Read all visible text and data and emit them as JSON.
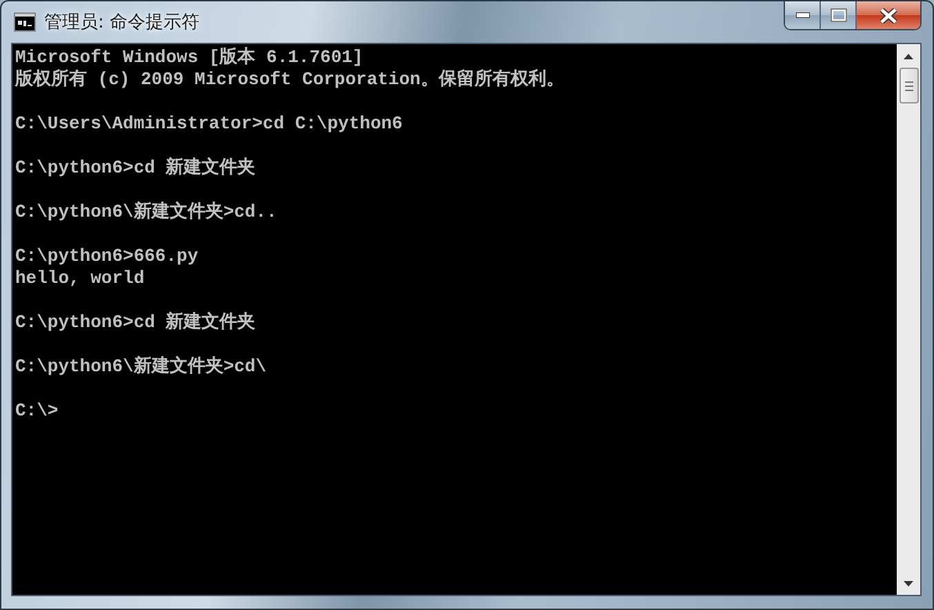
{
  "window": {
    "title": "管理员: 命令提示符"
  },
  "console": {
    "lines": [
      {
        "kind": "text",
        "text": "Microsoft Windows [版本 6.1.7601]"
      },
      {
        "kind": "text",
        "text": "版权所有 (c) 2009 Microsoft Corporation。保留所有权利。"
      },
      {
        "kind": "blank"
      },
      {
        "kind": "text",
        "text": "C:\\Users\\Administrator>cd C:\\python6"
      },
      {
        "kind": "blank"
      },
      {
        "kind": "text",
        "text": "C:\\python6>cd 新建文件夹"
      },
      {
        "kind": "blank"
      },
      {
        "kind": "text",
        "text": "C:\\python6\\新建文件夹>cd.."
      },
      {
        "kind": "blank"
      },
      {
        "kind": "text",
        "text": "C:\\python6>666.py"
      },
      {
        "kind": "text",
        "text": "hello, world"
      },
      {
        "kind": "blank"
      },
      {
        "kind": "text",
        "text": "C:\\python6>cd 新建文件夹"
      },
      {
        "kind": "blank"
      },
      {
        "kind": "text",
        "text": "C:\\python6\\新建文件夹>cd\\"
      },
      {
        "kind": "blank"
      },
      {
        "kind": "text",
        "text": "C:\\>"
      }
    ]
  }
}
